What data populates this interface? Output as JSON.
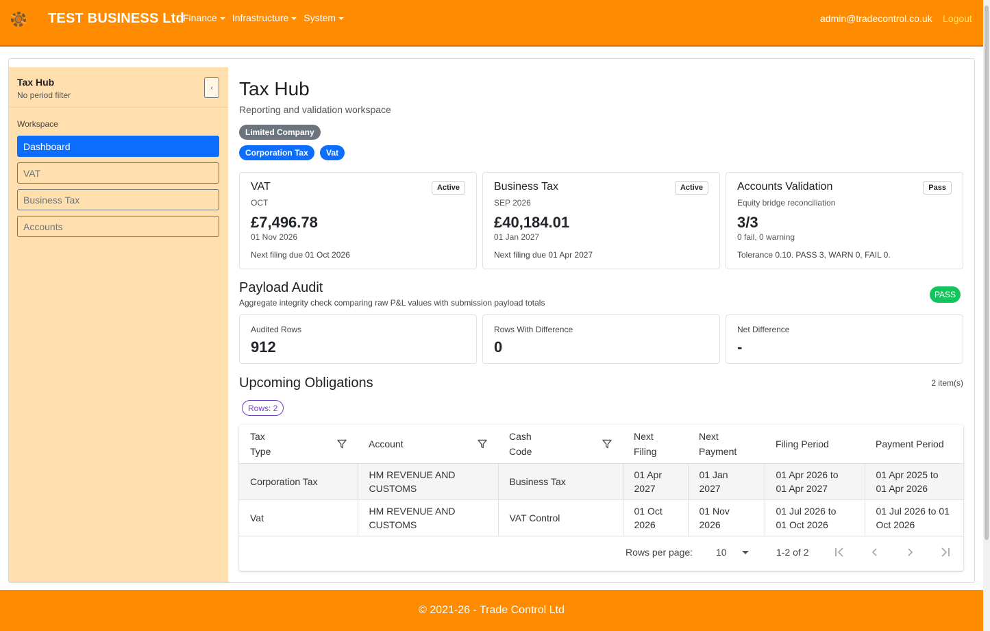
{
  "nav": {
    "brand": "TEST BUSINESS Ltd",
    "menus": [
      {
        "label": "Finance"
      },
      {
        "label": "Infrastructure"
      },
      {
        "label": "System"
      }
    ],
    "user": "admin@tradecontrol.co.uk",
    "logout": "Logout"
  },
  "sidebar": {
    "title": "Tax Hub",
    "subtitle": "No period filter",
    "collapse_glyph": "‹",
    "section": "Workspace",
    "items": [
      {
        "label": "Dashboard",
        "active": true
      },
      {
        "label": "VAT",
        "active": false
      },
      {
        "label": "Business Tax",
        "active": false
      },
      {
        "label": "Accounts",
        "active": false
      }
    ]
  },
  "header": {
    "title": "Tax Hub",
    "subtitle": "Reporting and validation workspace",
    "badges": [
      "Limited Company",
      "Corporation Tax",
      "Vat"
    ]
  },
  "cards": [
    {
      "title": "VAT",
      "status": "Active",
      "sub": "OCT",
      "value": "£7,496.78",
      "date": "01 Nov 2026",
      "note": "Next filing due 01 Oct 2026"
    },
    {
      "title": "Business Tax",
      "status": "Active",
      "sub": "SEP 2026",
      "value": "£40,184.01",
      "date": "01 Jan 2027",
      "note": "Next filing due 01 Apr 2027"
    },
    {
      "title": "Accounts Validation",
      "status": "Pass",
      "sub": "Equity bridge reconciliation",
      "value": "3/3",
      "date": "0 fail, 0 warning",
      "note": "Tolerance 0.10. PASS 3, WARN 0, FAIL 0."
    }
  ],
  "audit": {
    "title": "Payload Audit",
    "subtitle": "Aggregate integrity check comparing raw P&L values with submission payload totals",
    "status": "PASS",
    "stats": [
      {
        "label": "Audited Rows",
        "value": "912"
      },
      {
        "label": "Rows With Difference",
        "value": "0"
      },
      {
        "label": "Net Difference",
        "value": "-"
      }
    ]
  },
  "obligations": {
    "title": "Upcoming Obligations",
    "count": "2 item(s)",
    "rows_chip": "Rows: 2",
    "columns": [
      {
        "l1": "Tax",
        "l2": "Type"
      },
      {
        "l1": "Account",
        "l2": ""
      },
      {
        "l1": "Cash",
        "l2": "Code"
      },
      {
        "l1": "Next",
        "l2": "Filing"
      },
      {
        "l1": "Next",
        "l2": "Payment"
      },
      {
        "l1": "Filing Period",
        "l2": ""
      },
      {
        "l1": "Payment Period",
        "l2": ""
      }
    ],
    "rows": [
      {
        "tax_type": "Corporation Tax",
        "account_l1": "HM REVENUE AND",
        "account_l2": "CUSTOMS",
        "cash_code": "Business Tax",
        "next_filing_l1": "01 Apr",
        "next_filing_l2": "2027",
        "next_payment_l1": "01 Jan",
        "next_payment_l2": "2027",
        "filing_l1": "01 Apr 2026 to",
        "filing_l2": "01 Apr 2027",
        "payment_l1": "01 Apr 2025 to",
        "payment_l2": "01 Apr 2026"
      },
      {
        "tax_type": "Vat",
        "account_l1": "HM REVENUE AND",
        "account_l2": "CUSTOMS",
        "cash_code": "VAT Control",
        "next_filing_l1": "01 Oct",
        "next_filing_l2": "2026",
        "next_payment_l1": "01 Nov",
        "next_payment_l2": "2026",
        "filing_l1": "01 Jul 2026 to",
        "filing_l2": "01 Oct 2026",
        "payment_l1": "01 Jul 2026 to 01",
        "payment_l2": "Oct 2026"
      }
    ],
    "pager": {
      "rows_per_page_label": "Rows per page:",
      "rows_per_page": "10",
      "range": "1-2 of 2"
    }
  },
  "footer": "© 2021-26 - Trade Control Ltd"
}
